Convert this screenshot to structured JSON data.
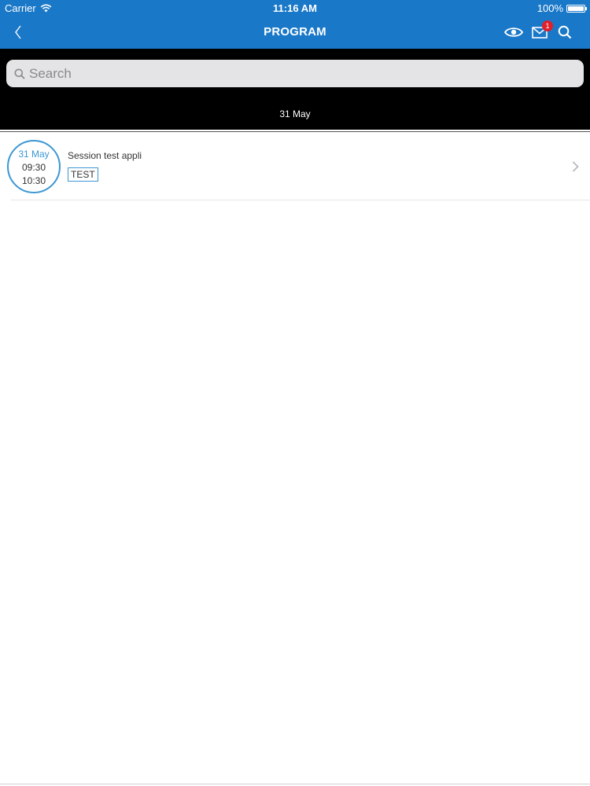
{
  "status_bar": {
    "carrier": "Carrier",
    "time": "11:16 AM",
    "battery": "100%",
    "battery_level": 1.0
  },
  "nav": {
    "title": "PROGRAM",
    "back_icon": "chevron-left-icon",
    "actions": [
      {
        "icon": "eye-icon"
      },
      {
        "icon": "mail-icon",
        "badge": "1"
      },
      {
        "icon": "search-icon"
      }
    ]
  },
  "search": {
    "placeholder": "Search",
    "value": ""
  },
  "date_header": "31 May",
  "sessions": [
    {
      "date": "31 May",
      "start": "09:30",
      "end": "10:30",
      "title": "Session test appli",
      "tag": "TEST"
    }
  ],
  "colors": {
    "nav_bar": "#1a78c8",
    "accent": "#3c97d3",
    "badge": "#e0202a",
    "search_bg": "#000000"
  }
}
